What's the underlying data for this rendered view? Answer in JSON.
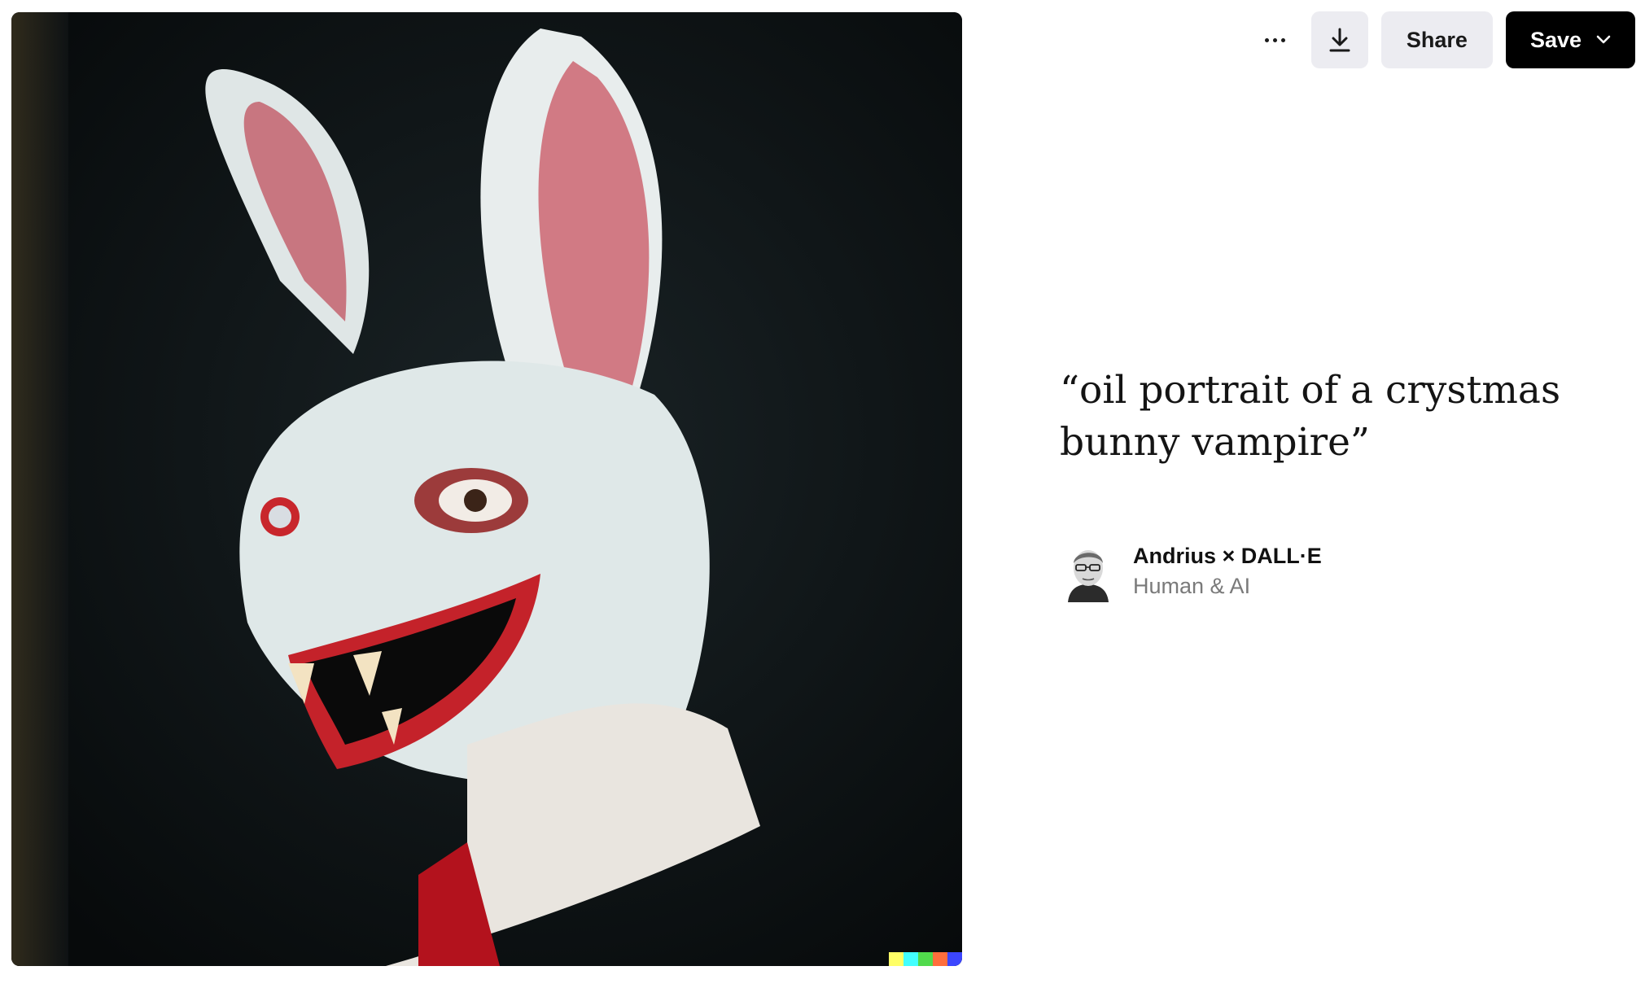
{
  "toolbar": {
    "more_icon": "more-horizontal-icon",
    "download_icon": "download-icon",
    "share_label": "Share",
    "save_label": "Save",
    "save_dropdown_icon": "chevron-down-icon"
  },
  "artwork": {
    "signature_colors": [
      "#ffff66",
      "#42ffff",
      "#51da4c",
      "#ff6e3c",
      "#3c46ff"
    ]
  },
  "prompt": {
    "text": "“oil portrait of a crystmas bunny vampire”"
  },
  "credit": {
    "author": "Andrius × DALL·E",
    "role": "Human & AI"
  }
}
